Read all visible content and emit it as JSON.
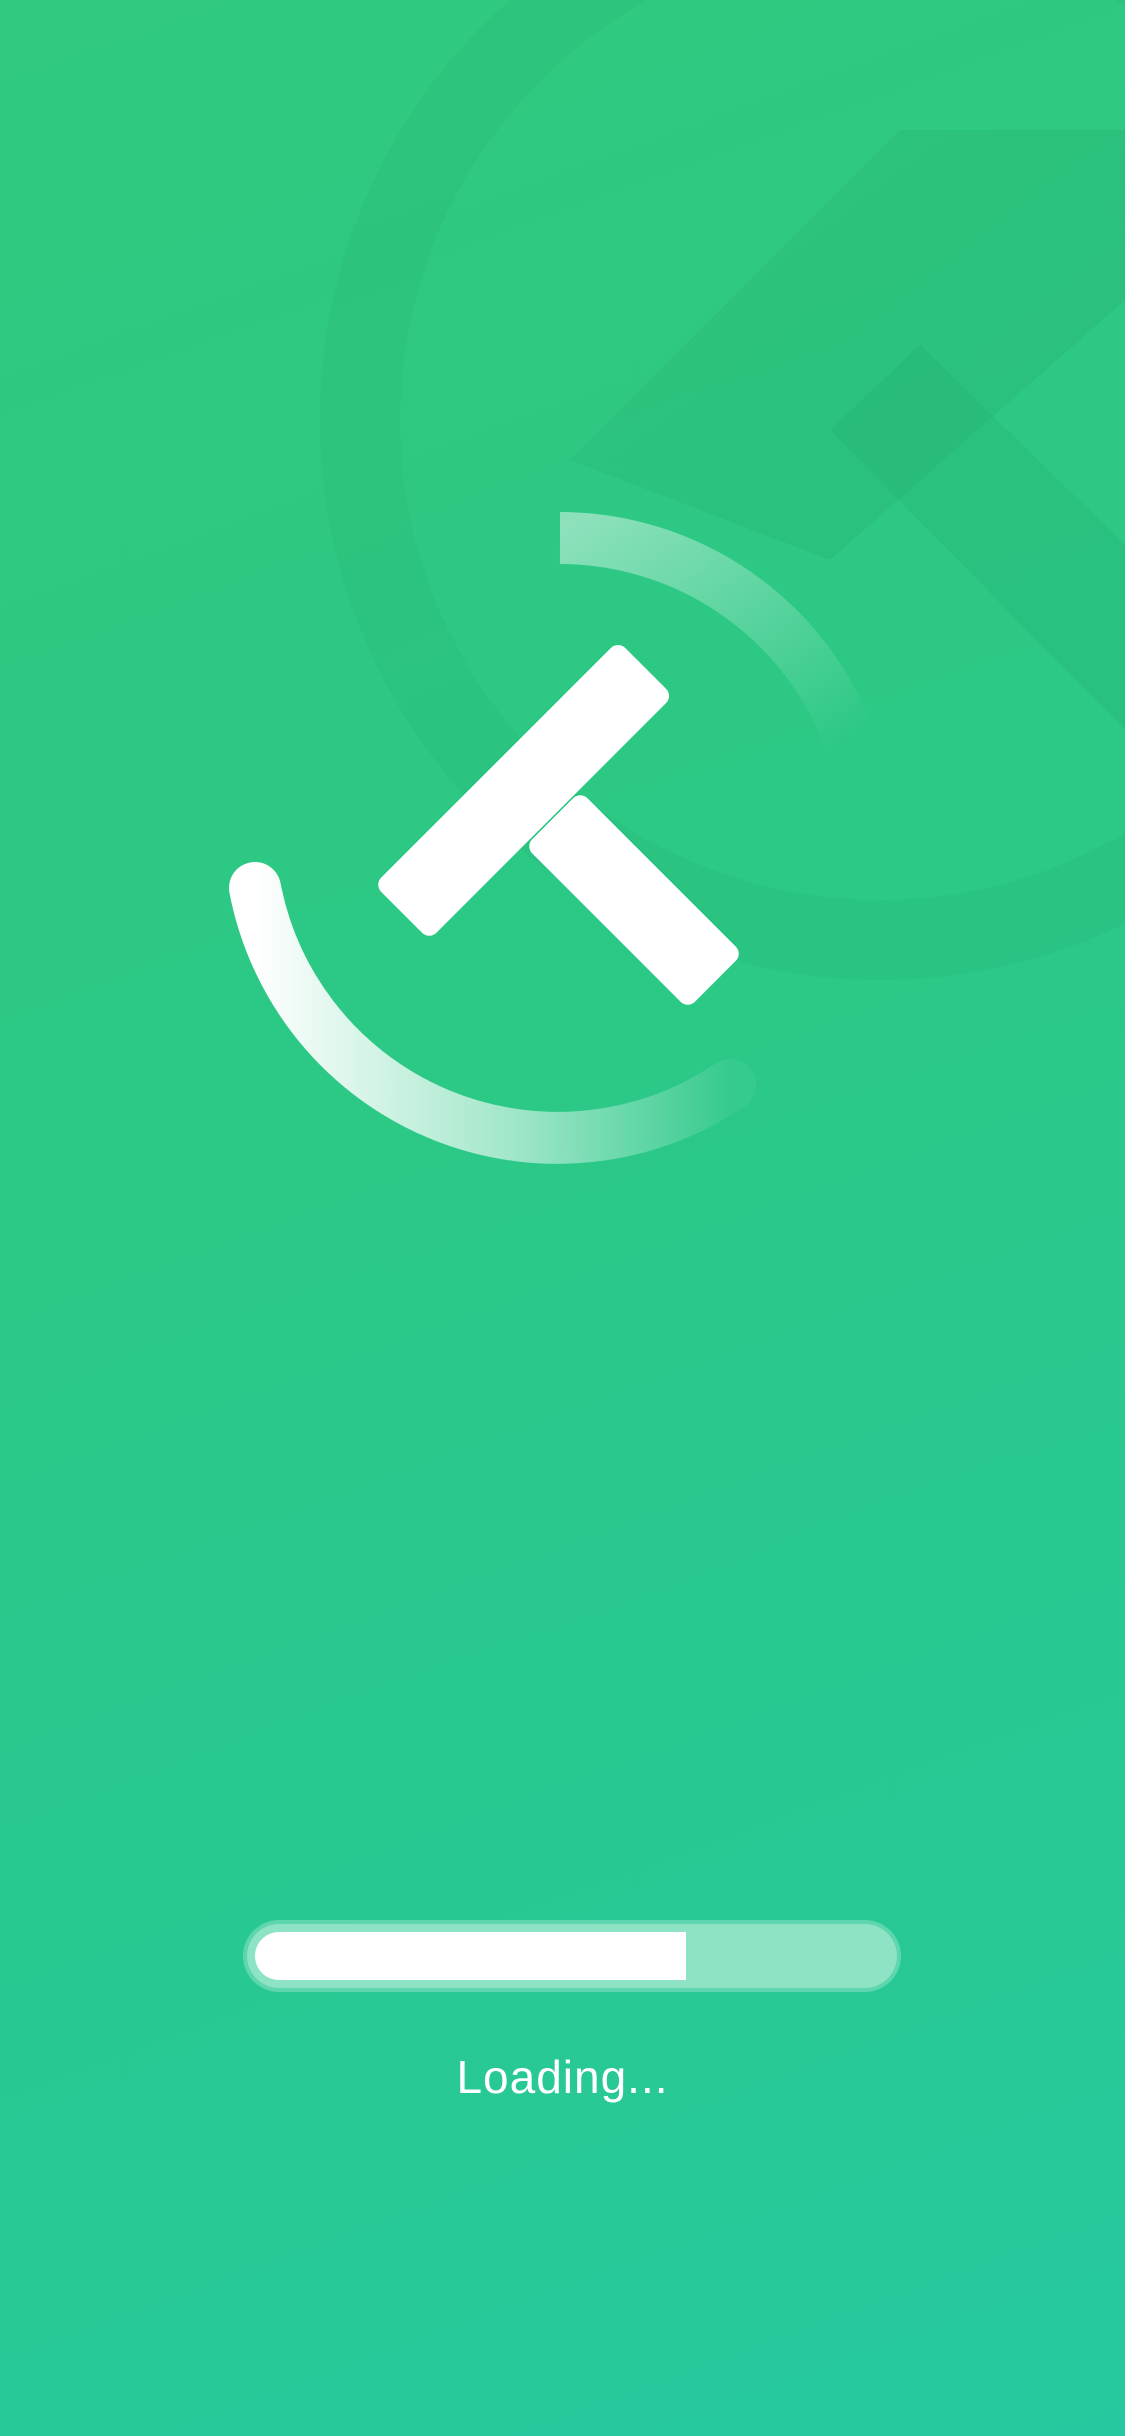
{
  "splash": {
    "loading_label": "Loading...",
    "progress": 0.68
  },
  "colors": {
    "background_top": "#30c97f",
    "background_bottom": "#26c99f",
    "progress_track": "#8de3c4",
    "progress_fill": "#ffffff",
    "text": "#ffffff"
  },
  "icons": {
    "logo": "app-logo-icon"
  }
}
